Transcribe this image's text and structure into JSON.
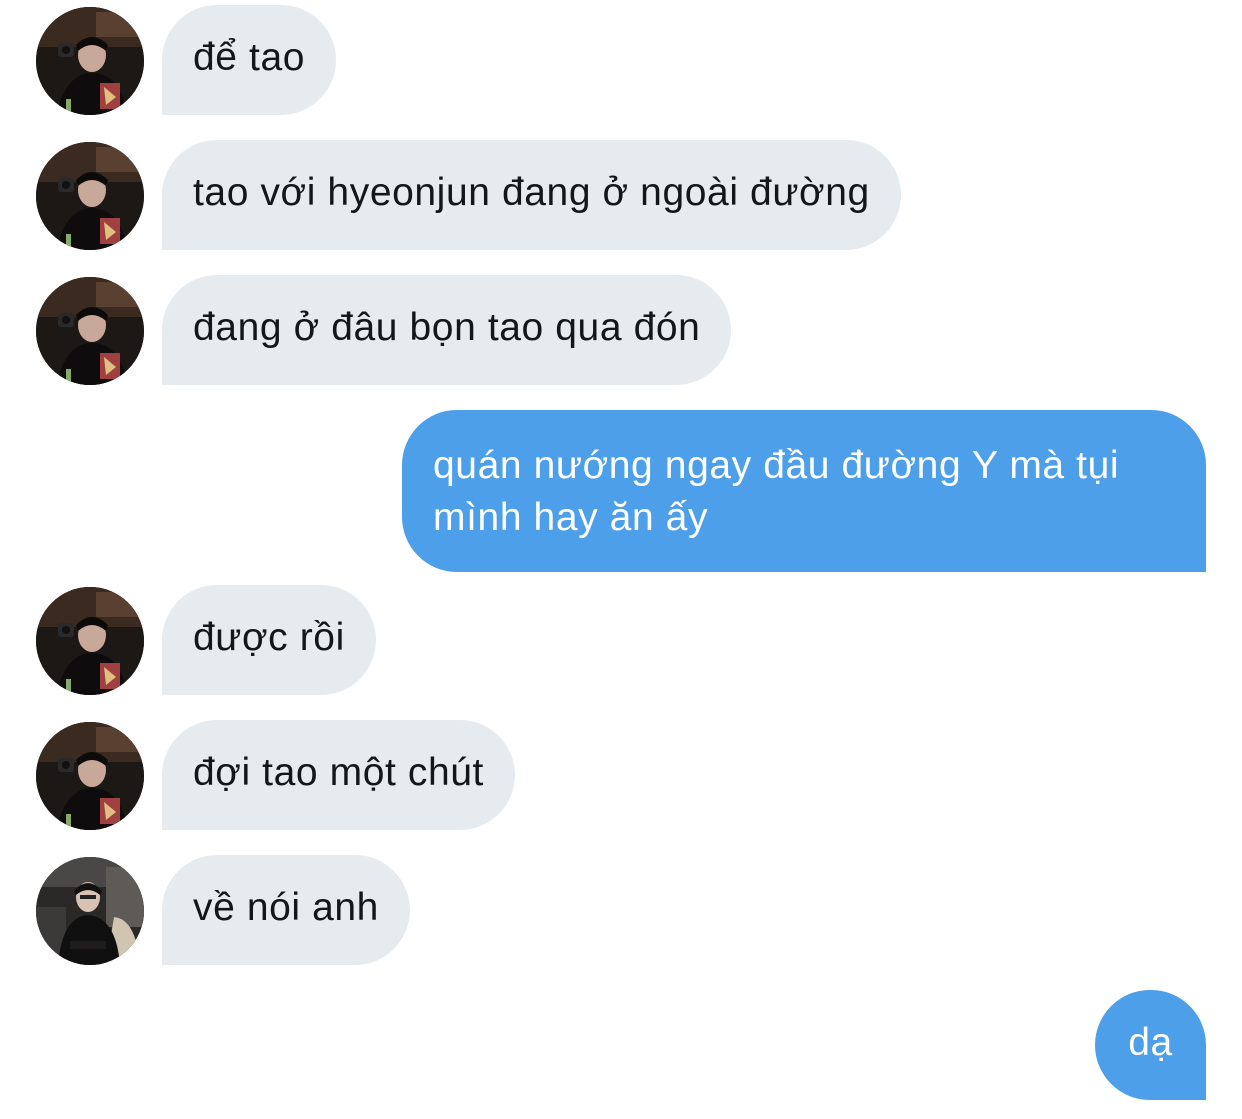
{
  "conversation": {
    "messages": [
      {
        "direction": "incoming",
        "avatar": "avatar-photo-1",
        "text": "để tao"
      },
      {
        "direction": "incoming",
        "avatar": "avatar-photo-1",
        "text": "tao với hyeonjun đang ở ngoài đường"
      },
      {
        "direction": "incoming",
        "avatar": "avatar-photo-1",
        "text": "đang ở đâu bọn tao qua đón"
      },
      {
        "direction": "outgoing",
        "lines": [
          "quán nướng ngay đầu đường Y mà tụi",
          "mình hay ăn ấy"
        ]
      },
      {
        "direction": "incoming",
        "avatar": "avatar-photo-1",
        "text": "được rồi"
      },
      {
        "direction": "incoming",
        "avatar": "avatar-photo-1",
        "text": "đợi tao một chút"
      },
      {
        "direction": "incoming",
        "avatar": "avatar-photo-2",
        "text": "về nói anh"
      },
      {
        "direction": "outgoing",
        "text": "dạ"
      }
    ]
  },
  "colors": {
    "incoming_bubble": "#e6ebef",
    "incoming_text": "#14171a",
    "outgoing_bubble": "#4d9fe9",
    "outgoing_text": "#ffffff"
  }
}
